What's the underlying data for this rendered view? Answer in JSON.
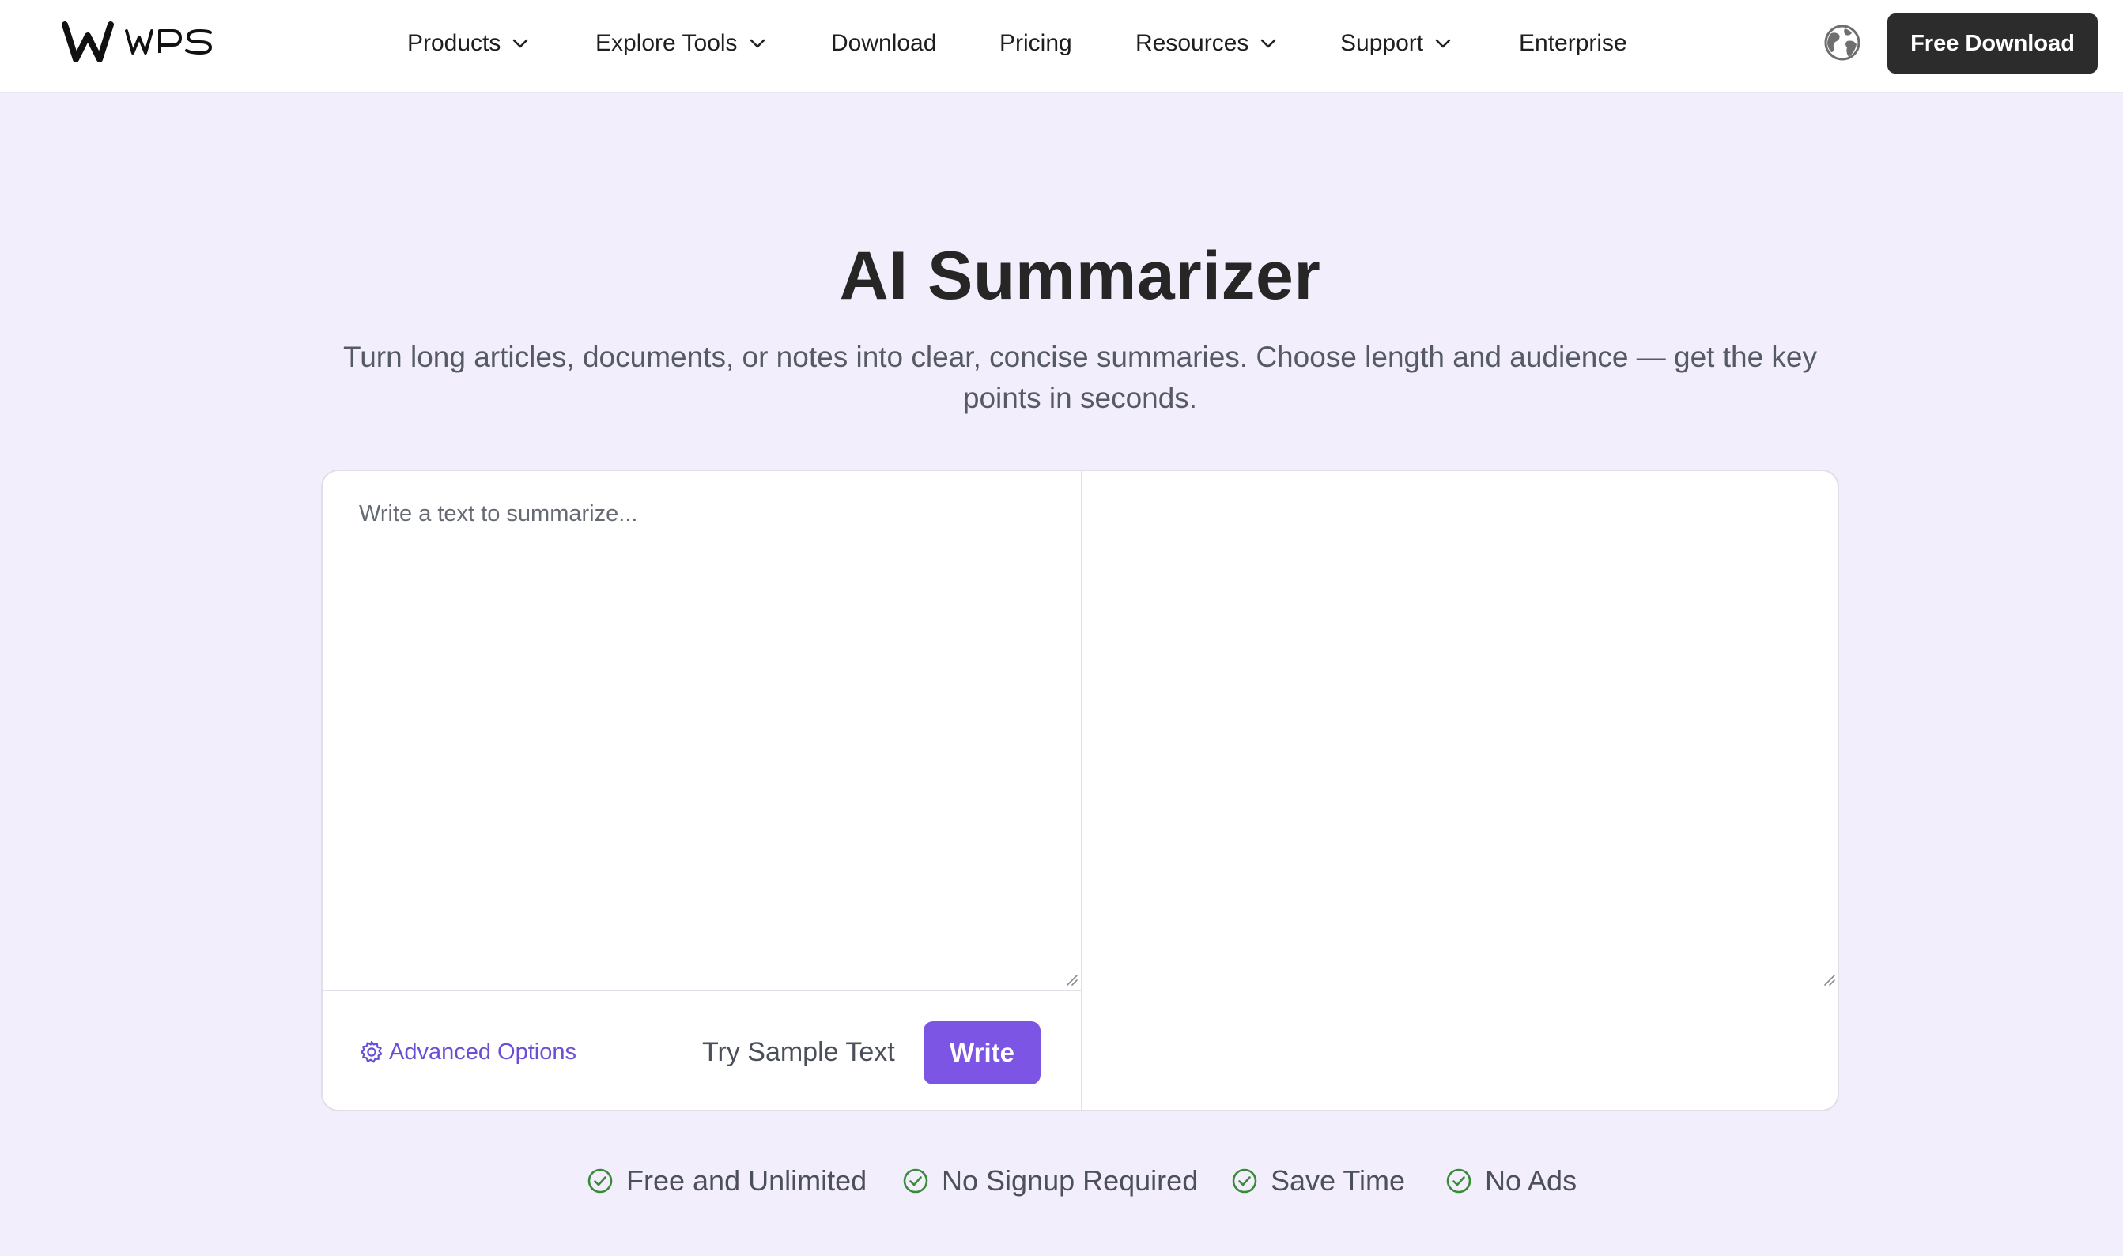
{
  "brand": {
    "name": "WPS"
  },
  "nav": {
    "items": [
      {
        "label": "Products",
        "has_dropdown": true
      },
      {
        "label": "Explore Tools",
        "has_dropdown": true
      },
      {
        "label": "Download",
        "has_dropdown": false
      },
      {
        "label": "Pricing",
        "has_dropdown": false
      },
      {
        "label": "Resources",
        "has_dropdown": true
      },
      {
        "label": "Support",
        "has_dropdown": true
      },
      {
        "label": "Enterprise",
        "has_dropdown": false
      }
    ],
    "language_icon": "globe-icon",
    "cta_label": "Free Download"
  },
  "hero": {
    "title": "AI Summarizer",
    "subtitle": "Turn long articles, documents, or notes into clear, concise summaries. Choose length and audience — get the key points in seconds."
  },
  "tool": {
    "input_placeholder": "Write a text to summarize...",
    "input_value": "",
    "output_value": "",
    "advanced_options_label": "Advanced Options",
    "sample_text_label": "Try Sample Text",
    "write_label": "Write"
  },
  "features": [
    {
      "label": "Free and Unlimited",
      "icon": "check-circle-icon"
    },
    {
      "label": "No Signup Required",
      "icon": "check-circle-icon"
    },
    {
      "label": "Save Time",
      "icon": "check-circle-icon"
    },
    {
      "label": "No Ads",
      "icon": "check-circle-icon"
    }
  ],
  "colors": {
    "accent": "#7c55e4",
    "link": "#6b4ed8",
    "page_bg": "#f2eefb",
    "cta_bg": "#2c2c2c",
    "check_green": "#3a8a3a"
  }
}
